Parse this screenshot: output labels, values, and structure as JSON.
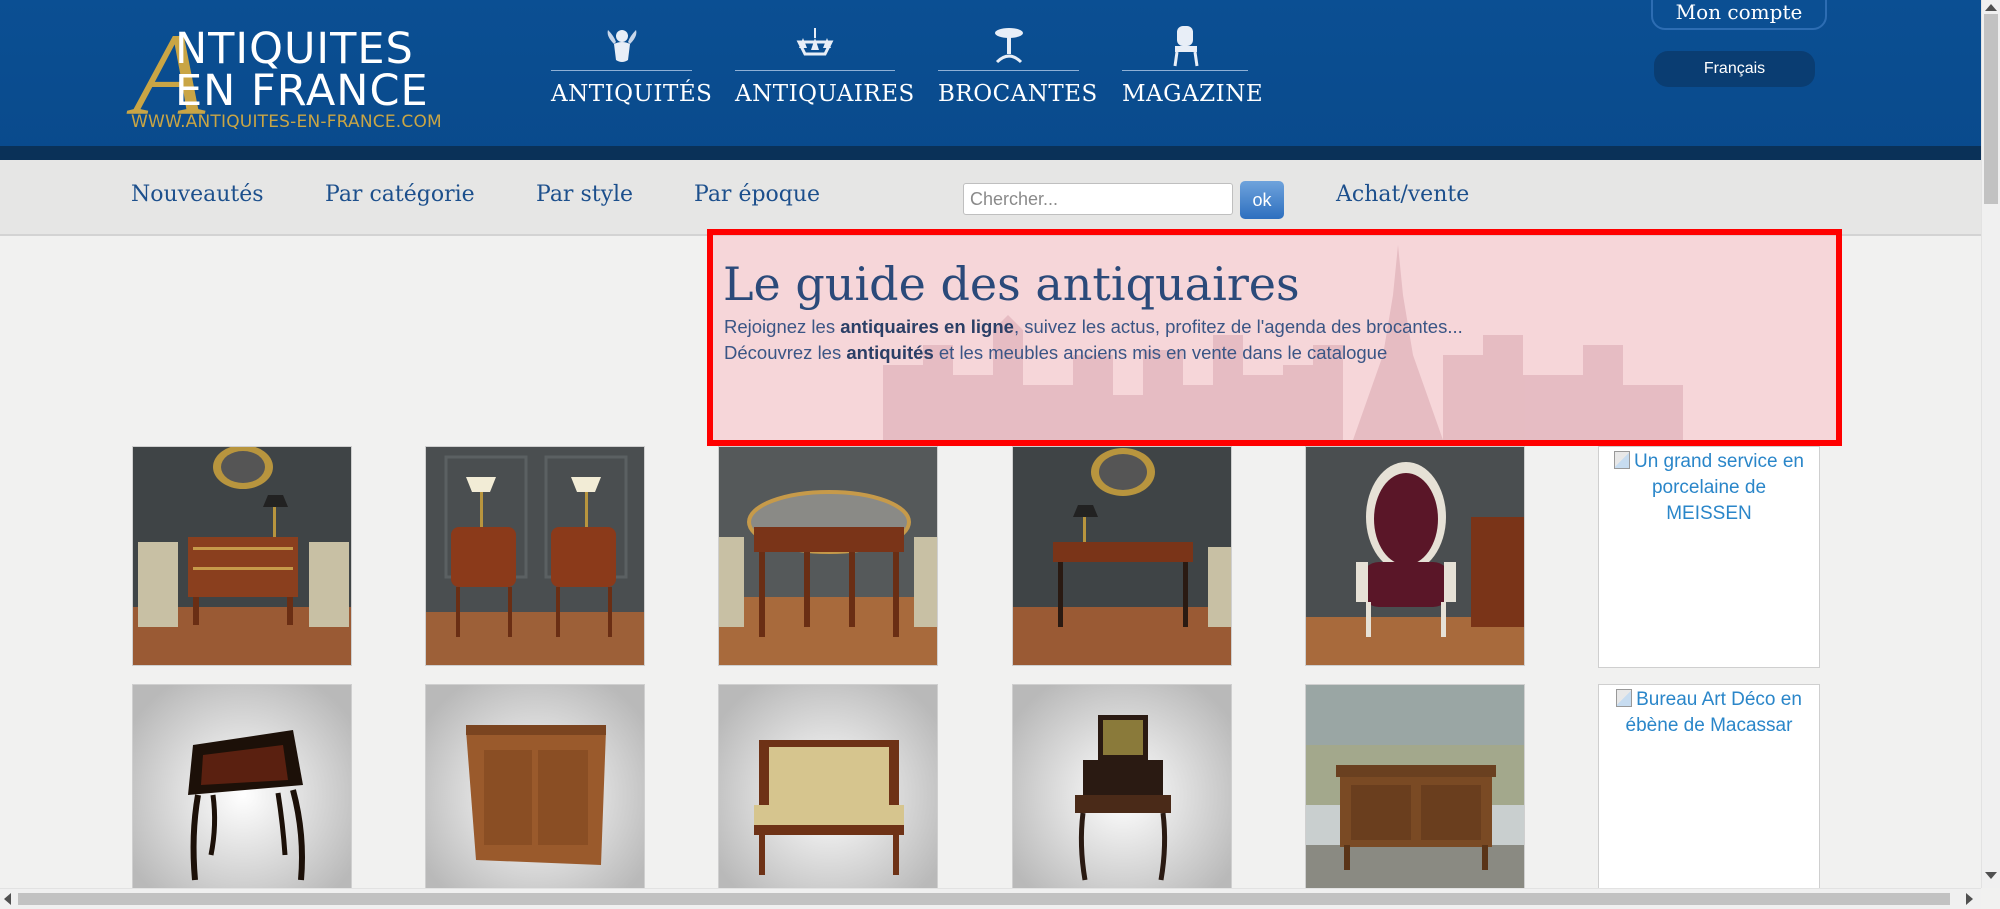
{
  "brand": {
    "logo_initial": "A",
    "logo_line1": "NTIQUITES",
    "logo_line2": "EN FRANCE",
    "logo_url": "WWW.ANTIQUITES-EN-FRANCE.COM"
  },
  "main_nav": [
    {
      "label": "ANTIQUITÉS",
      "icon": "cherub-icon"
    },
    {
      "label": "ANTIQUAIRES",
      "icon": "chandelier-icon"
    },
    {
      "label": "BROCANTES",
      "icon": "pedestal-table-icon"
    },
    {
      "label": "MAGAZINE",
      "icon": "armchair-icon"
    }
  ],
  "account": {
    "label": "Mon compte"
  },
  "language": {
    "label": "Français"
  },
  "sub_nav": [
    {
      "label": "Nouveautés"
    },
    {
      "label": "Par catégorie"
    },
    {
      "label": "Par style"
    },
    {
      "label": "Par époque"
    }
  ],
  "search": {
    "placeholder": "Chercher...",
    "value": "",
    "button_label": "ok"
  },
  "achat_vente": {
    "label": "Achat/vente"
  },
  "hero": {
    "title": "Le guide des antiquaires",
    "line1_pre": "Rejoignez les ",
    "line1_bold": "antiquaires en ligne",
    "line1_post": ", suivez les actus, profitez de l'agenda des brocantes...",
    "line2_pre": "Découvrez les ",
    "line2_bold": "antiquités",
    "line2_post": " et les meubles anciens mis en vente dans le catalogue"
  },
  "ads": [
    {
      "alt": "Un grand service en porcelaine de MEISSEN"
    },
    {
      "alt": "Bureau Art Déco en ébène de Macassar"
    }
  ],
  "colors": {
    "header_blue": "#0b4f93",
    "gold": "#c9a545",
    "link_blue": "#1c4f8c",
    "highlight_border": "#ff0000",
    "ad_link": "#2a86c9"
  }
}
